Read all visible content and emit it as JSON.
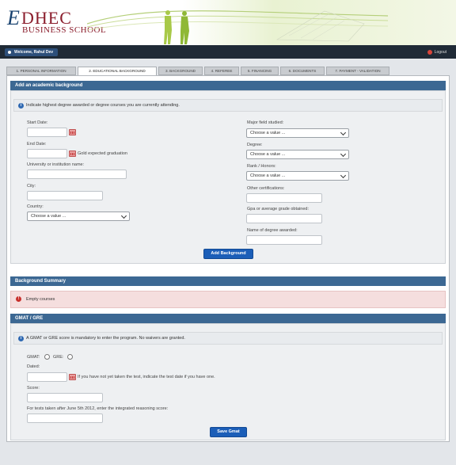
{
  "brand": {
    "initial": "E",
    "name_main": "DHEC",
    "name_sub": "BUSINESS SCHOOL"
  },
  "topbar": {
    "welcome": "Welcome, Rahul Dev",
    "logout": "Logout"
  },
  "tabs": [
    {
      "label": "1. Personal Information"
    },
    {
      "label": "2. Educational Background"
    },
    {
      "label": "3. Background"
    },
    {
      "label": "4. Referee"
    },
    {
      "label": "5. Financing"
    },
    {
      "label": "6. Documents"
    },
    {
      "label": "7. Payment - Validation"
    }
  ],
  "academic": {
    "title": "Add an academic background",
    "info": "Indicate highest degree awarded or degree courses you are currently attending.",
    "start_date_label": "Start Date:",
    "end_date_label": "End Date:",
    "gold_label": "Gold expected graduation",
    "university_label": "University or institution name:",
    "city_label": "City:",
    "country_label": "Country:",
    "country_value": "Choose a value ...",
    "major_label": "Major field studied:",
    "major_value": "Choose a value ...",
    "degree_label": "Degree:",
    "degree_value": "Choose a value ...",
    "rank_label": "Rank / Honors:",
    "rank_value": "Choose a value ...",
    "other_cert_label": "Other certifications:",
    "gpa_label": "Gpa or average grade obtained:",
    "degree_name_label": "Name of degree awarded:",
    "add_button": "Add Background"
  },
  "summary": {
    "title": "Background Summary",
    "empty": "Empty courses"
  },
  "gmat": {
    "title": "GMAT / GRE",
    "info": "A GMAT or GRE score is mandatory to enter the program. No waivers are granted.",
    "gmat_label": "GMAT:",
    "gre_label": "GRE:",
    "dated_label": "Dated:",
    "date_hint": "If you have not yet taken the test, indicate the test date if you have one.",
    "score_label": "Score:",
    "ir_label": "For tests taken after June 5th 2012, enter the integrated reasoning score:",
    "save_button": "Save Gmat"
  },
  "colors": {
    "section_header": "#3c6893",
    "button": "#1b5eb8",
    "brand_red": "#8b1d2c",
    "error_bg": "#f5dede"
  }
}
